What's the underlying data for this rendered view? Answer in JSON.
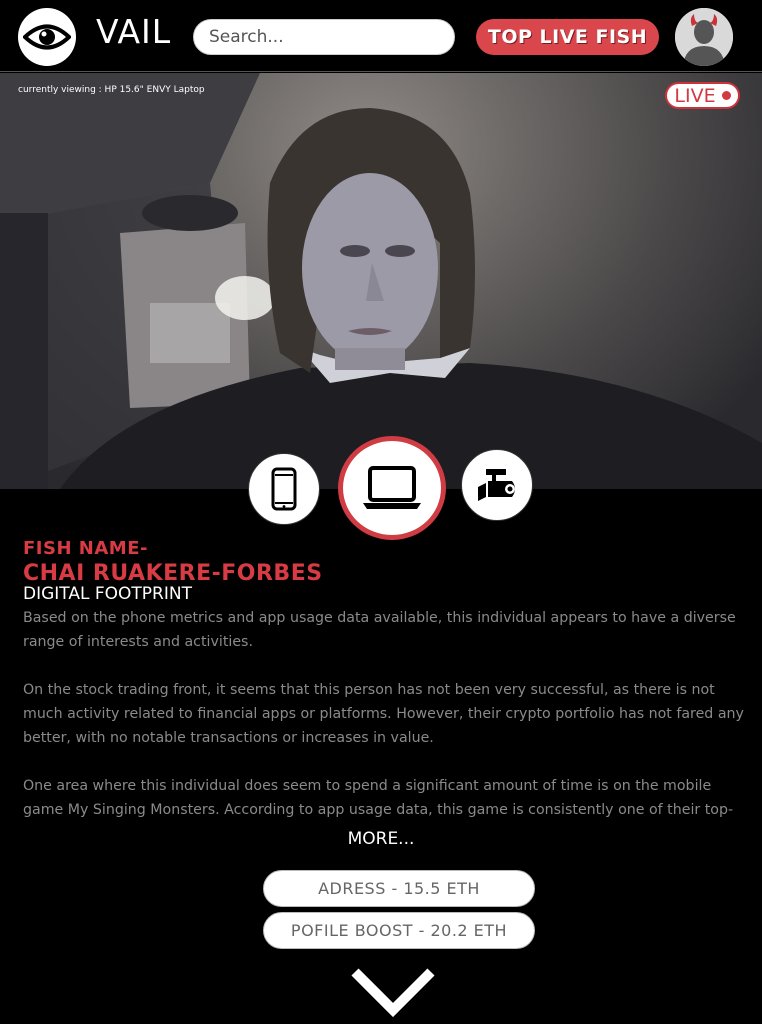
{
  "header": {
    "logo_icon": "eye-icon",
    "brand": "VAIL",
    "search_placeholder": "Search...",
    "top_button": "TOP LIVE FISH",
    "avatar_icon": "devil-avatar-icon"
  },
  "stream": {
    "currently_viewing": "currently viewing : HP 15.6\" ENVY Laptop",
    "live_label": "LIVE",
    "live_color": "#d23a42"
  },
  "devices": [
    {
      "name": "phone",
      "icon": "smartphone-icon",
      "active": false
    },
    {
      "name": "laptop",
      "icon": "laptop-icon",
      "active": true
    },
    {
      "name": "camera",
      "icon": "security-camera-icon",
      "active": false
    }
  ],
  "profile": {
    "label": "FISH NAME-",
    "name": "CHAI RUAKERE-FORBES",
    "section_title": "DIGITAL FOOTPRINT",
    "paragraphs": [
      "Based on the phone metrics and app usage data available, this individual appears to have a diverse range of interests and activities.",
      "On the stock trading front, it seems that this person has not been very successful, as there is not much activity related to financial apps or platforms. However, their crypto portfolio has not fared any better, with no notable transactions or increases in value.",
      "One area where this individual does seem to spend a significant amount of time is on the mobile game My Singing Monsters. According to app usage data, this game is consistently one of their top-used apps,"
    ],
    "more_label": "MORE..."
  },
  "actions": [
    {
      "label": "ADRESS - 15.5 ETH"
    },
    {
      "label": "POFILE BOOST - 20.2 ETH"
    }
  ],
  "accent_color": "#d83b43"
}
